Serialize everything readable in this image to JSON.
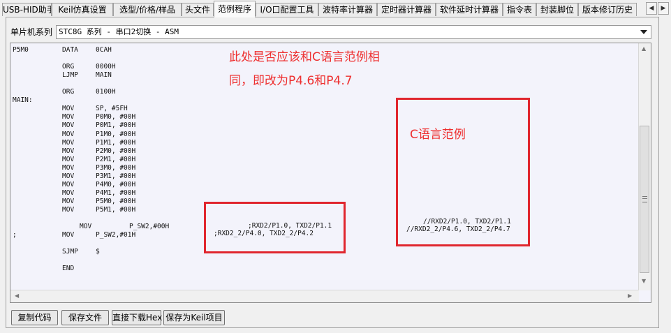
{
  "tabs": [
    {
      "label": "USB-HID助手",
      "active": false
    },
    {
      "label": "Keil仿真设置",
      "active": false
    },
    {
      "label": "选型/价格/样品",
      "active": false
    },
    {
      "label": "头文件",
      "active": false
    },
    {
      "label": "范例程序",
      "active": true
    },
    {
      "label": "I/O口配置工具",
      "active": false
    },
    {
      "label": "波特率计算器",
      "active": false
    },
    {
      "label": "定时器计算器",
      "active": false
    },
    {
      "label": "软件延时计算器",
      "active": false
    },
    {
      "label": "指令表",
      "active": false
    },
    {
      "label": "封装脚位",
      "active": false
    },
    {
      "label": "版本修订历史",
      "active": false
    }
  ],
  "tab_nav": {
    "left": "◀",
    "right": "▶"
  },
  "mcu_label": "单片机系列",
  "mcu_selected": "STC8G 系列 - 串口2切换 - ASM",
  "code_lines": [
    {
      "c1": "P5M0",
      "c2": "DATA",
      "c3": "0CAH",
      "row": 0
    },
    {
      "c1": "",
      "c2": "ORG",
      "c3": "0000H",
      "row": 2
    },
    {
      "c1": "",
      "c2": "LJMP",
      "c3": "MAIN",
      "row": 3
    },
    {
      "c1": "",
      "c2": "ORG",
      "c3": "0100H",
      "row": 5
    },
    {
      "c1": "MAIN:",
      "c2": "",
      "c3": "",
      "row": 6
    },
    {
      "c1": "",
      "c2": "MOV",
      "c3": "SP, #5FH",
      "row": 7
    },
    {
      "c1": "",
      "c2": "MOV",
      "c3": "P0M0, #00H",
      "row": 8
    },
    {
      "c1": "",
      "c2": "MOV",
      "c3": "P0M1, #00H",
      "row": 9
    },
    {
      "c1": "",
      "c2": "MOV",
      "c3": "P1M0, #00H",
      "row": 10
    },
    {
      "c1": "",
      "c2": "MOV",
      "c3": "P1M1, #00H",
      "row": 11
    },
    {
      "c1": "",
      "c2": "MOV",
      "c3": "P2M0, #00H",
      "row": 12
    },
    {
      "c1": "",
      "c2": "MOV",
      "c3": "P2M1, #00H",
      "row": 13
    },
    {
      "c1": "",
      "c2": "MOV",
      "c3": "P3M0, #00H",
      "row": 14
    },
    {
      "c1": "",
      "c2": "MOV",
      "c3": "P3M1, #00H",
      "row": 15
    },
    {
      "c1": "",
      "c2": "MOV",
      "c3": "P4M0, #00H",
      "row": 16
    },
    {
      "c1": "",
      "c2": "MOV",
      "c3": "P4M1, #00H",
      "row": 17
    },
    {
      "c1": "",
      "c2": "MOV",
      "c3": "P5M0, #00H",
      "row": 18
    },
    {
      "c1": "",
      "c2": "MOV",
      "c3": "P5M1, #00H",
      "row": 19
    },
    {
      "c1": "",
      "c2": "MOV",
      "c3": "P_SW2,#00H",
      "row": 21,
      "shift": true
    },
    {
      "c1": ";",
      "c2": "MOV",
      "c3": "P_SW2,#01H",
      "row": 22
    },
    {
      "c1": "",
      "c2": "SJMP",
      "c3": "$",
      "row": 24
    },
    {
      "c1": "",
      "c2": "END",
      "c3": "",
      "row": 26
    }
  ],
  "asm_comment_1": ";RXD2/P1.0, TXD2/P1.1",
  "asm_comment_2": ";RXD2_2/P4.0, TXD2_2/P4.2",
  "c_comment_1": "//RXD2/P1.0, TXD2/P1.1",
  "c_comment_2": "//RXD2_2/P4.6, TXD2_2/P4.7",
  "annotation_line1": "此处是否应该和C语言范例相",
  "annotation_line2": "同，即改为P4.6和P4.7",
  "annotation_c_example": "C语言范例",
  "buttons": {
    "copy_code": "复制代码",
    "save_file": "保存文件",
    "direct_download": "直接下载Hex",
    "save_keil": "保存为Keil项目"
  },
  "colors": {
    "annotation_red": "#e0262e"
  }
}
